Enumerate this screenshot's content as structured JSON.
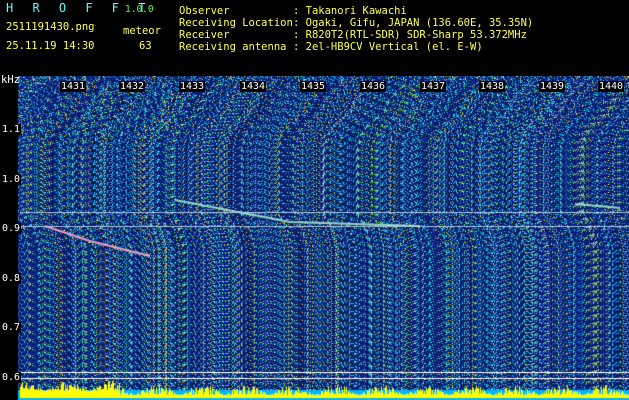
{
  "header": {
    "app_name": "H R O F F T",
    "version": "1.0.0",
    "filename": "2511191430.png",
    "datetime": "25.11.19 14:30",
    "mode_label": "meteor",
    "count": "63",
    "fields": [
      {
        "label": "Observer",
        "value": ": Takanori Kawachi"
      },
      {
        "label": "Receiving Location",
        "value": ": Ogaki, Gifu, JAPAN (136.60E, 35.35N)"
      },
      {
        "label": "Receiver",
        "value": ": R820T2(RTL-SDR) SDR-Sharp 53.372MHz"
      },
      {
        "label": "Receiving antenna",
        "value": ": 2el-HB9CV Vertical (el. E-W)"
      }
    ]
  },
  "spectrogram": {
    "unit_label": "kHz",
    "time_ticks": [
      "1431",
      "1432",
      "1433",
      "1434",
      "1435",
      "1436",
      "1437",
      "1438",
      "1439",
      "1440"
    ],
    "freq_ticks": [
      "1.1",
      "1.0",
      "0.9",
      "0.8",
      "0.7",
      "0.6"
    ]
  },
  "colors": {
    "background": "#000000",
    "noise_base": "#10208a",
    "signal": "#c8d8ff",
    "baseline": "#ffffff",
    "bottom_bar": "#ffff00",
    "bottom_base": "#00b4ff",
    "header_yellow": "#ffff55",
    "header_cyan": "#55ffff"
  }
}
